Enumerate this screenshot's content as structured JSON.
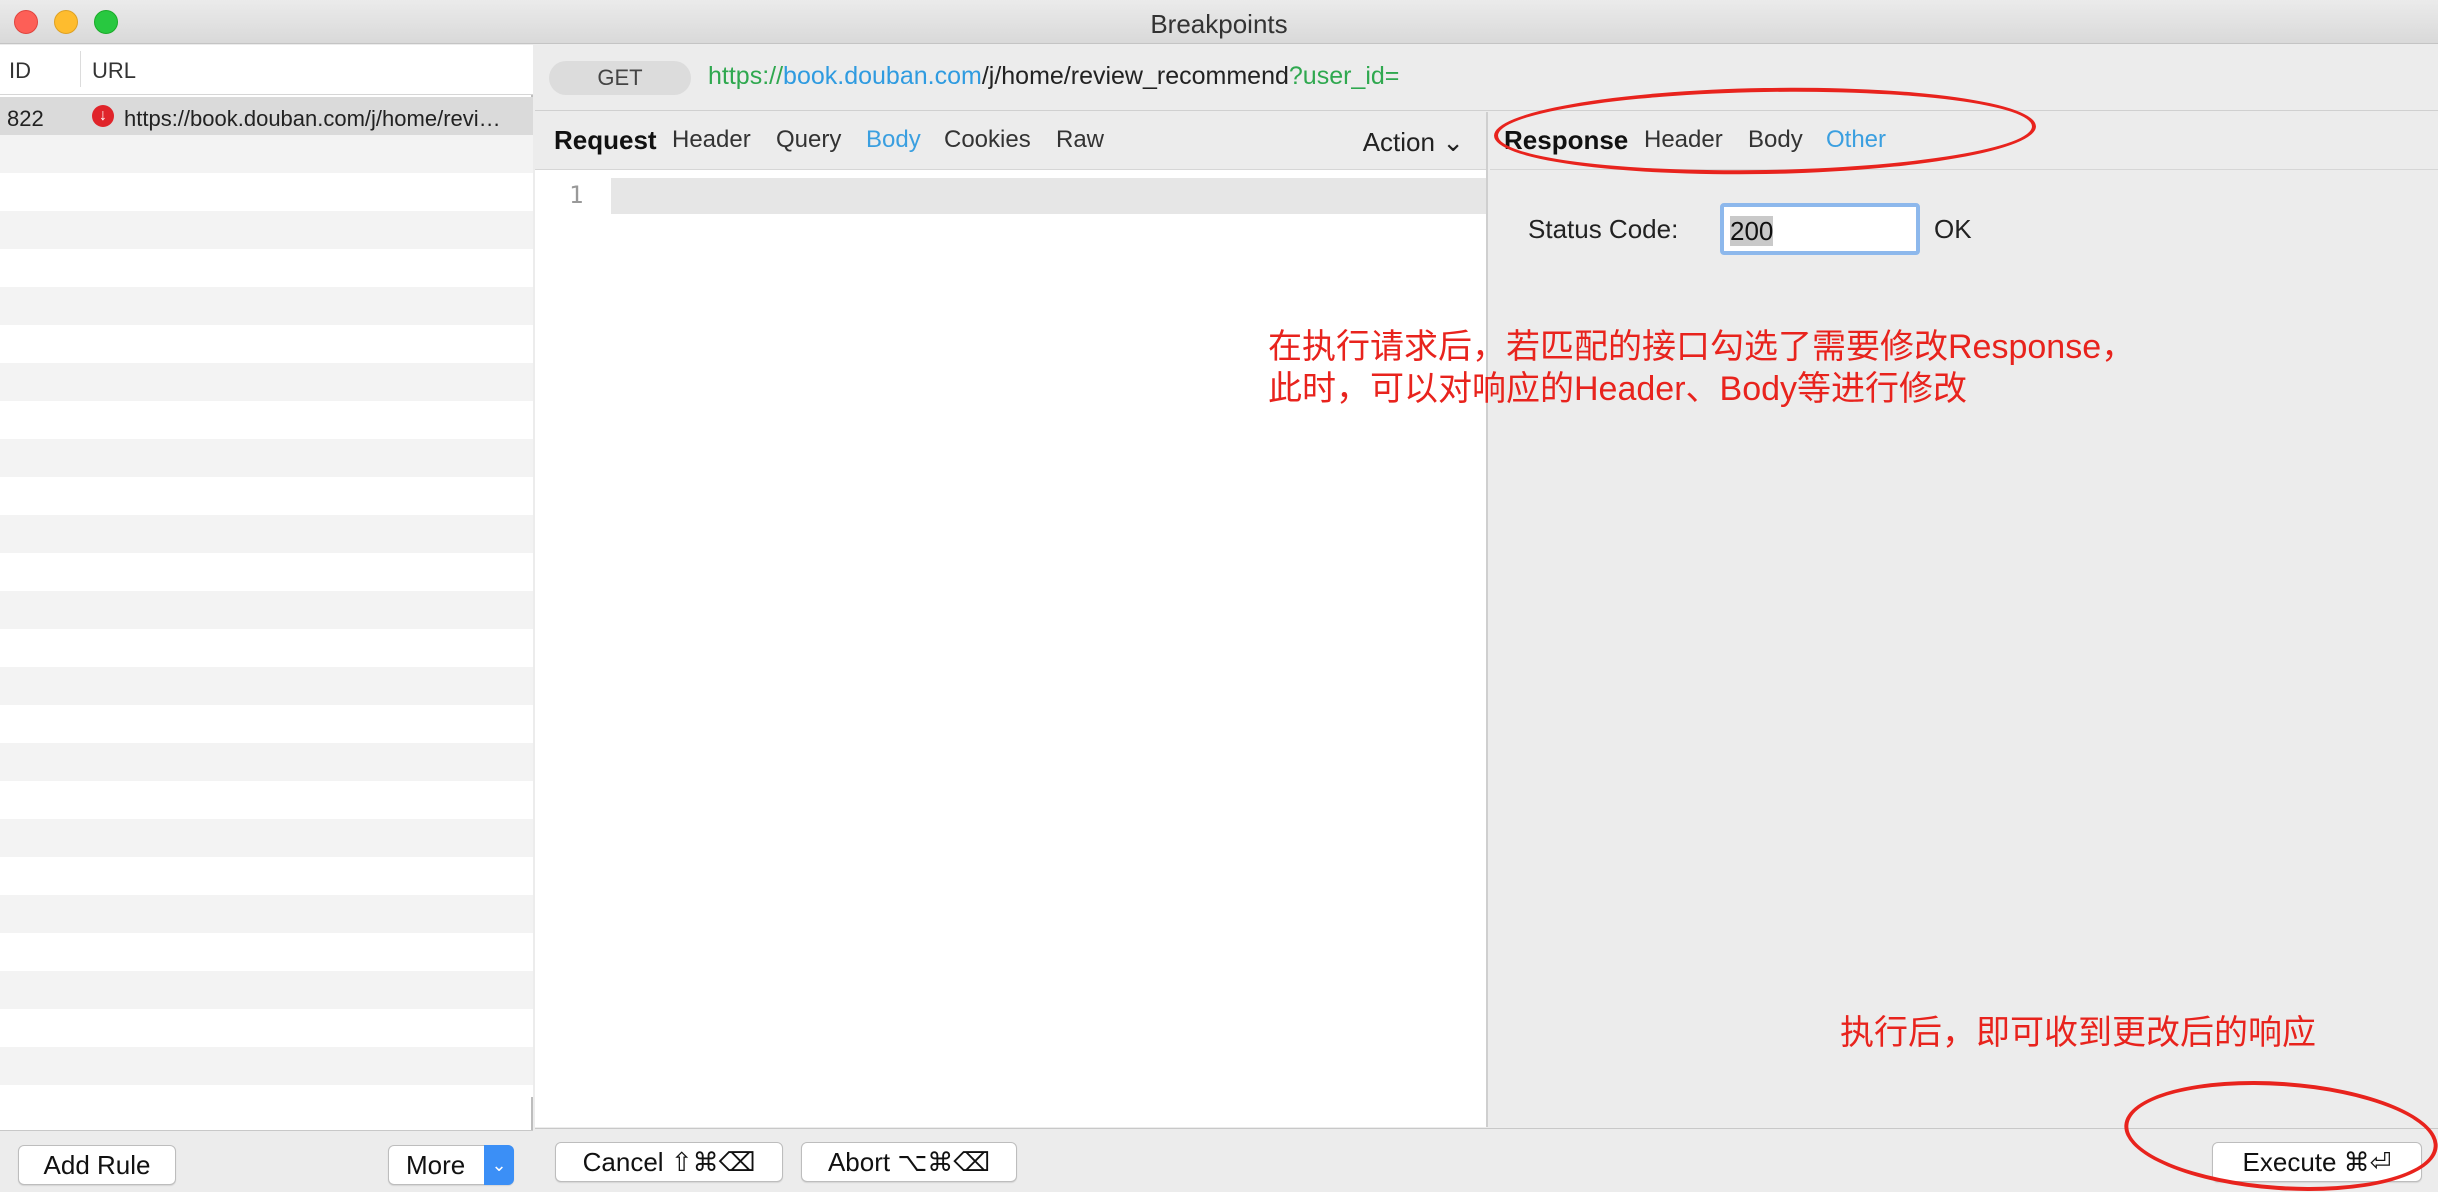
{
  "window": {
    "title": "Breakpoints"
  },
  "list": {
    "col_id": "ID",
    "col_url": "URL",
    "selected": {
      "id": "822",
      "url": "https://book.douban.com/j/home/revi…",
      "icon": "error-icon"
    },
    "footer": {
      "add_rule": "Add Rule",
      "more": "More",
      "more_arrow": "⌄"
    }
  },
  "request_bar": {
    "method": "GET",
    "url_scheme": "https://",
    "url_host": "book.douban.com",
    "url_path": "/j/home/review_recommend",
    "url_query": "?user_id="
  },
  "request": {
    "label": "Request",
    "tabs": [
      "Header",
      "Query",
      "Body",
      "Cookies",
      "Raw"
    ],
    "active_tab": "Body",
    "action": "Action ⌄",
    "line_number": "1"
  },
  "response": {
    "label": "Response",
    "tabs": [
      "Header",
      "Body",
      "Other"
    ],
    "active_tab": "Other",
    "status_label": "Status Code:",
    "status_value": "200",
    "status_text": "OK"
  },
  "buttons": {
    "cancel": "Cancel ⇧⌘⌫",
    "abort": "Abort ⌥⌘⌫",
    "execute": "Execute ⌘⏎"
  },
  "annotations": {
    "note1_line1": "在执行请求后，若匹配的接口勾选了需要修改Response，",
    "note1_line2": "此时，可以对响应的Header、Body等进行修改",
    "note2": "执行后，即可收到更改后的响应",
    "color": "#e8231d"
  },
  "colors": {
    "accent": "#3a9fe0",
    "url_green": "#2fa84f",
    "url_blue": "#2f9be0"
  }
}
